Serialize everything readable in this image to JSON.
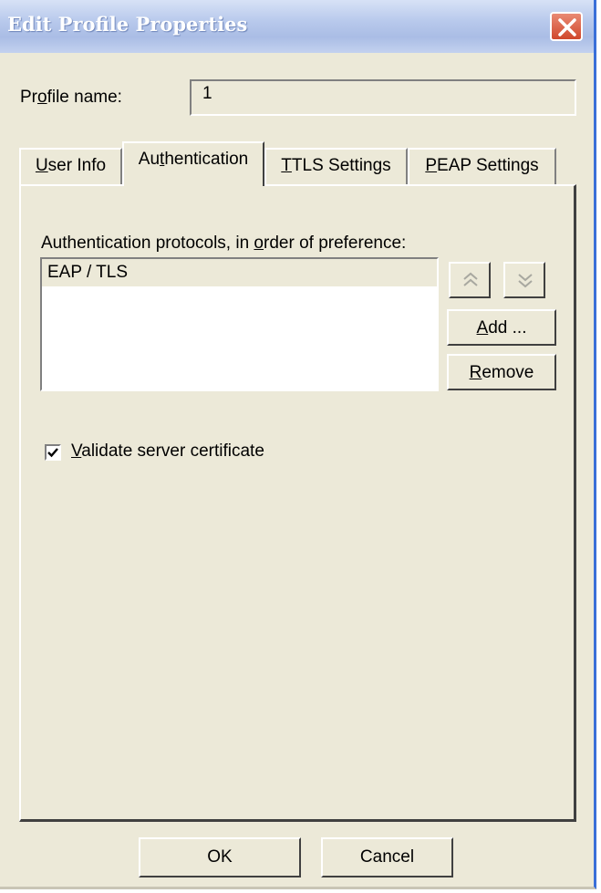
{
  "window": {
    "title": "Edit Profile Properties",
    "title_color": "#ffffff",
    "titlebar_color": "#b8c9ec",
    "close_button_color": "#d0472c",
    "background_color": "#ece9d8"
  },
  "profile": {
    "label": "Profile name:",
    "value": "1"
  },
  "tabs": [
    {
      "label": "User Info",
      "active": false
    },
    {
      "label": "Authentication",
      "active": true
    },
    {
      "label": "TTLS Settings",
      "active": false
    },
    {
      "label": "PEAP Settings",
      "active": false
    }
  ],
  "authentication": {
    "protocols_label": "Authentication protocols, in order of preference:",
    "protocols": [
      "EAP / TLS"
    ],
    "move_up_icon": "double-chevron-up-icon",
    "move_down_icon": "double-chevron-down-icon",
    "add_label": "Add ...",
    "remove_label": "Remove",
    "validate_cert_label": "Validate server certificate",
    "validate_cert_checked": true
  },
  "footer": {
    "ok_label": "OK",
    "cancel_label": "Cancel"
  }
}
